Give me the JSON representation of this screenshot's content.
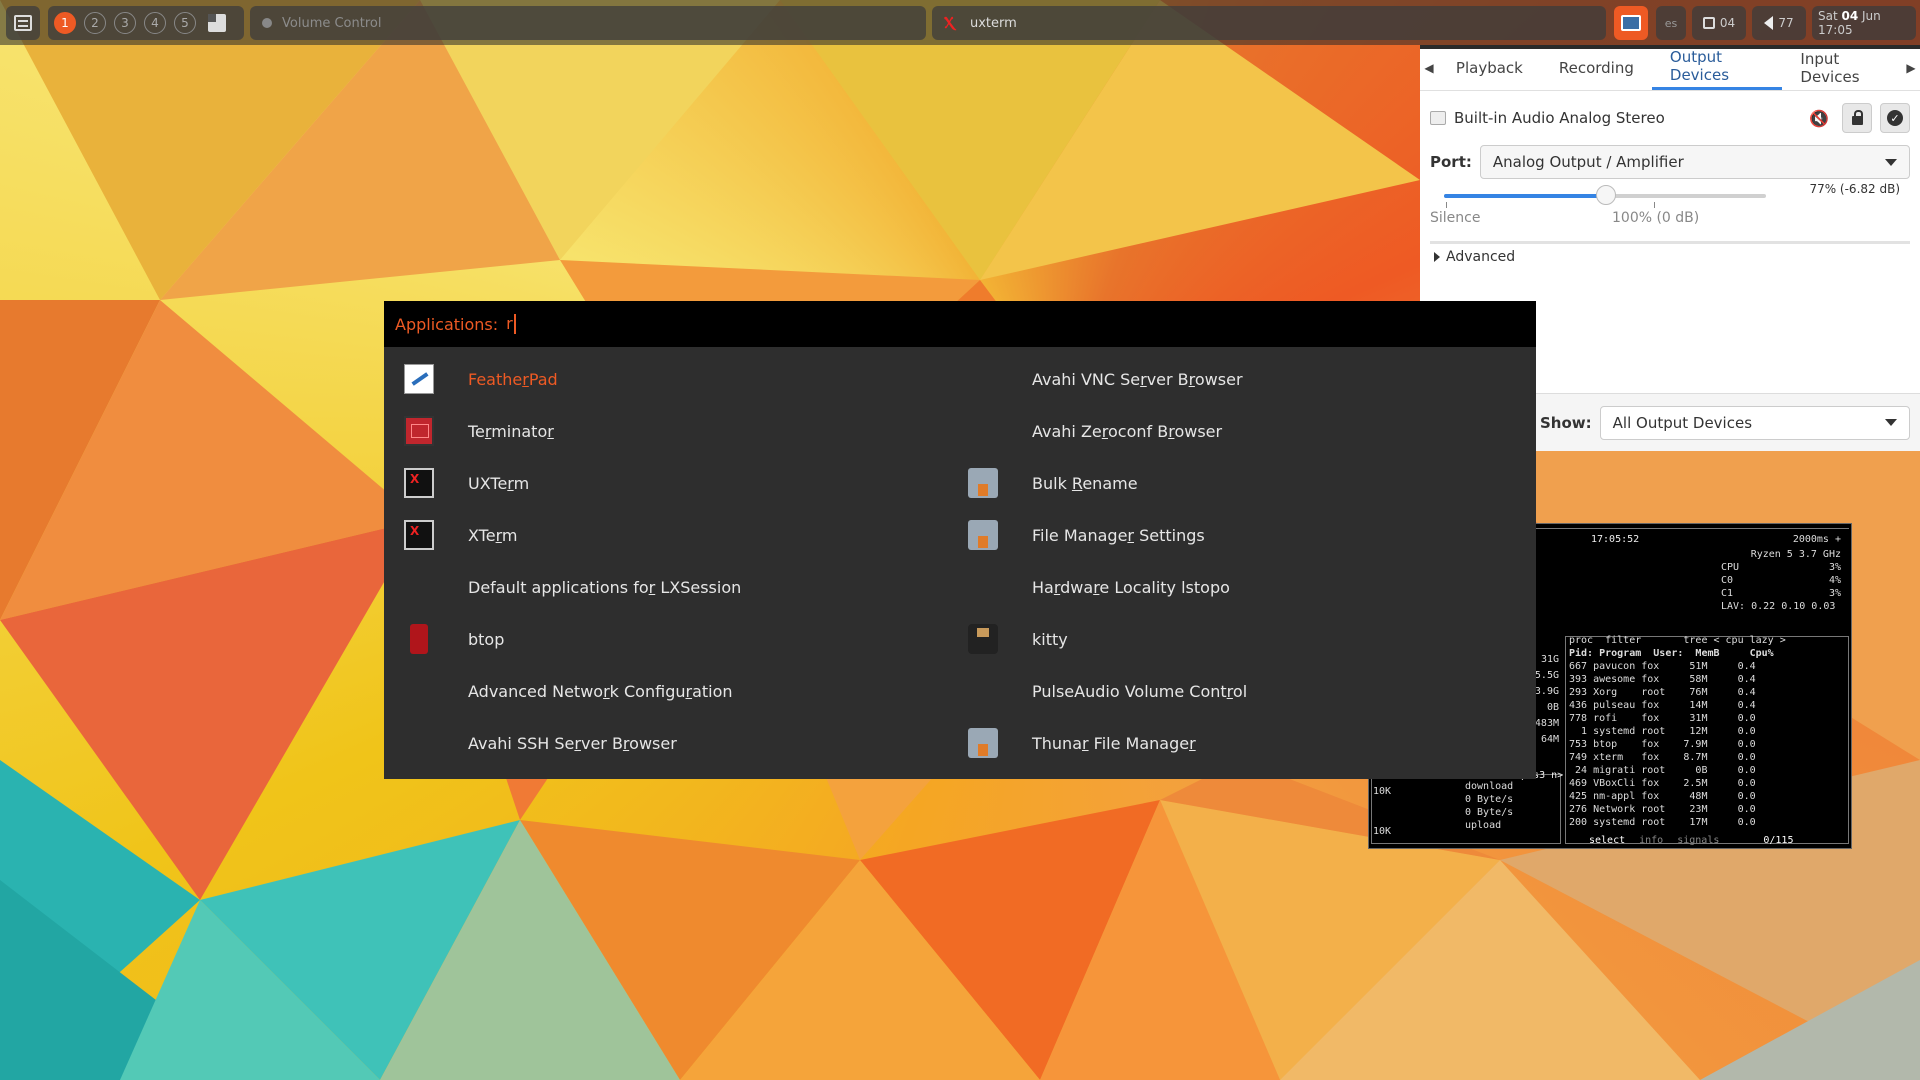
{
  "topbar": {
    "tags": [
      "1",
      "2",
      "3",
      "4",
      "5"
    ],
    "active_tag": "1",
    "tasks": [
      {
        "title": "Volume Control",
        "icon": "volume-control-app-icon"
      },
      {
        "title": "uxterm",
        "icon": "xterm-icon"
      }
    ],
    "tray": {
      "keyboard_layout": "es",
      "cpu_value": "04",
      "volume_value": "77",
      "clock_day": "Sat ",
      "clock_date": "04",
      "clock_rest": " Jun 17:05"
    },
    "colors": {
      "accent": "#ee5a24",
      "bar_bg": "#3c3c3c"
    }
  },
  "volume_control": {
    "tabs": [
      "Playback",
      "Recording",
      "Output Devices",
      "Input Devices"
    ],
    "active_tab": "Output Devices",
    "device": {
      "name": "Built-in Audio Analog Stereo",
      "port_label": "Port:",
      "port_value": "Analog Output / Amplifier",
      "volume_text": "77% (-6.82 dB)",
      "volume_fraction": 0.77,
      "silence_label": "Silence",
      "norm_label": "100% (0 dB)",
      "advanced_label": "Advanced"
    },
    "show_label": "Show:",
    "show_value": "All Output Devices"
  },
  "btop": {
    "clock": "17:05:52",
    "update_ms": "2000ms +",
    "cpu_model": "Ryzen 5  3.7 GHz",
    "cpu_rows": [
      {
        "name": "CPU",
        "value": "3%"
      },
      {
        "name": "C0",
        "value": "4%"
      },
      {
        "name": "C1",
        "value": "3%"
      }
    ],
    "load_avg": "LAV: 0.22 0.10 0.03",
    "proc_header": "proc  filter       tree < cpu lazy >",
    "proc_columns": "Pid: Program  User:  MemB     Cpu%",
    "processes": [
      "667 pavucon fox     51M     0.4",
      "393 awesome fox     58M     0.4",
      "293 Xorg    root    76M     0.4",
      "436 pulseau fox     14M     0.4",
      "778 rofi    fox     31M     0.0",
      "  1 systemd root    12M     0.0",
      "753 btop    fox    7.9M     0.0",
      "749 xterm   fox    8.7M     0.0",
      " 24 migrati root     0B     0.0",
      "469 VBoxCli fox    2.5M     0.0",
      "425 nm-appl fox     48M     0.0",
      "276 Network root    23M     0.0",
      "200 systemd root    17M     0.0"
    ],
    "mem_values": [
      "31G",
      "5.5G",
      "3.9G",
      "0B",
      "483M",
      "64M"
    ],
    "net": {
      "iface_label": "enp0s3 n>",
      "scale_high": "10K",
      "scale_low": "10K",
      "download_label": "download",
      "download_rate": "0 Byte/s",
      "upload_rate": "0 Byte/s",
      "upload_label": "upload"
    },
    "footer": {
      "select": "select",
      "info": "info",
      "signals": "signals",
      "count": "0/115"
    }
  },
  "rofi": {
    "prompt": "Applications:",
    "query": "r",
    "items_left": [
      {
        "pre": "Feathe",
        "hl": "r",
        "post": "Pad",
        "icon": "featherpad-icon",
        "selected": true
      },
      {
        "pre": "Te",
        "hl": "r",
        "post": "minato",
        "hl2": "r",
        "post2": "",
        "icon": "terminator-icon"
      },
      {
        "pre": "UXTe",
        "hl": "r",
        "post": "m",
        "icon": "uxterm-icon"
      },
      {
        "pre": "XTe",
        "hl": "r",
        "post": "m",
        "icon": "xterm-icon"
      },
      {
        "pre": "Default applications fo",
        "hl": "r",
        "post": " LXSession",
        "icon": ""
      },
      {
        "pre": "btop",
        "hl": "",
        "post": "",
        "icon": "btop-icon"
      },
      {
        "pre": "Advanced Netwo",
        "hl": "r",
        "post": "k Configu",
        "hl2": "r",
        "post2": "ation",
        "icon": ""
      },
      {
        "pre": "Avahi SSH Se",
        "hl": "r",
        "post": "ver B",
        "hl2": "r",
        "post2": "owser",
        "icon": ""
      }
    ],
    "items_right": [
      {
        "pre": "Avahi VNC Se",
        "hl": "r",
        "post": "ver B",
        "hl2": "r",
        "post2": "owser",
        "icon": ""
      },
      {
        "pre": "Avahi Ze",
        "hl": "r",
        "post": "oconf B",
        "hl2": "r",
        "post2": "owser",
        "icon": ""
      },
      {
        "pre": "Bulk ",
        "hl": "R",
        "post": "ename",
        "icon": "bulk-rename-icon"
      },
      {
        "pre": "File Manage",
        "hl": "r",
        "post": " Settings",
        "icon": "file-manager-settings-icon"
      },
      {
        "pre": "Ha",
        "hl": "r",
        "post": "dwa",
        "hl2": "r",
        "post2": "e Locality lstopo",
        "icon": ""
      },
      {
        "pre": "kitty",
        "hl": "",
        "post": "",
        "icon": "kitty-icon"
      },
      {
        "pre": "PulseAudio Volume Cont",
        "hl": "r",
        "post": "ol",
        "icon": ""
      },
      {
        "pre": "Thuna",
        "hl": "r",
        "post": " File Manage",
        "hl2": "r",
        "post2": "",
        "icon": "thunar-icon"
      }
    ]
  }
}
